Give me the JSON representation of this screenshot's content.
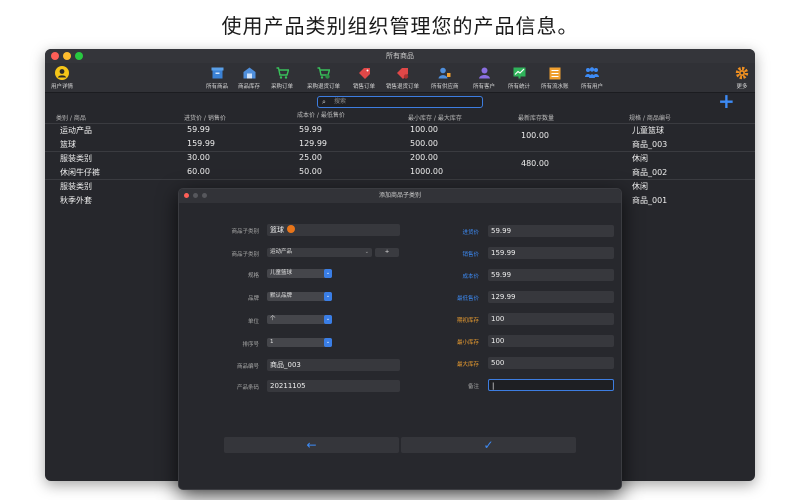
{
  "headline": "使用产品类别组织管理您的产品信息。",
  "window": {
    "title": "所有商品",
    "user_label": "用户详情",
    "more_label": "更多",
    "toolbar": [
      {
        "label": "所有商品",
        "icon": "box-icon"
      },
      {
        "label": "商品库存",
        "icon": "warehouse-icon"
      },
      {
        "label": "采购订单",
        "icon": "cart-icon"
      },
      {
        "label": "采购退货订单",
        "icon": "cart-return-icon"
      },
      {
        "label": "销售订单",
        "icon": "tag-icon"
      },
      {
        "label": "销售退货订单",
        "icon": "tag-return-icon"
      },
      {
        "label": "所有供应商",
        "icon": "supplier-icon"
      },
      {
        "label": "所有客户",
        "icon": "customers-icon"
      },
      {
        "label": "所有统计",
        "icon": "chart-icon"
      },
      {
        "label": "所有流水账",
        "icon": "ledger-icon"
      },
      {
        "label": "所有用户",
        "icon": "users-icon"
      }
    ],
    "search_placeholder": "搜索"
  },
  "table": {
    "headers": [
      "类别 / 商品",
      "进货价 / 销售价",
      "成本价 / 最低售价",
      "最小库存 / 最大库存",
      "最新库存数量",
      "规格 / 商品编号"
    ],
    "rows": [
      {
        "category": "运动产品",
        "product": "篮球",
        "purchase": "59.99",
        "sale": "159.99",
        "cost": "59.99",
        "min_price": "129.99",
        "min_stock": "100.00",
        "max_stock": "500.00",
        "stock": "100.00",
        "spec": "儿童篮球",
        "code": "商品_003"
      },
      {
        "category": "服装类别",
        "product": "休闲牛仔裤",
        "purchase": "30.00",
        "sale": "60.00",
        "cost": "25.00",
        "min_price": "50.00",
        "min_stock": "200.00",
        "max_stock": "1000.00",
        "stock": "480.00",
        "spec": "休闲",
        "code": "商品_002"
      },
      {
        "category": "服装类别",
        "product": "秋季外套",
        "spec": "休闲",
        "code": "商品_001"
      }
    ]
  },
  "dialog": {
    "title": "添加商品子类别",
    "left": {
      "subcategory_label": "商品子类别",
      "subcategory_value": "篮球",
      "category_label": "商品子类别",
      "category_value": "运动产品",
      "spec_label": "规格",
      "spec_value": "儿童篮球",
      "brand_label": "品牌",
      "brand_value": "默认品牌",
      "unit_label": "单位",
      "unit_value": "个",
      "sort_label": "排序号",
      "sort_value": "1",
      "code_label": "商品编号",
      "code_value": "商品_003",
      "barcode_label": "产品条码",
      "barcode_value": "20211105"
    },
    "right": {
      "purchase_label": "进货价",
      "purchase_value": "59.99",
      "sale_label": "销售价",
      "sale_value": "159.99",
      "cost_label": "成本价",
      "cost_value": "59.99",
      "min_price_label": "最低售价",
      "min_price_value": "129.99",
      "init_stock_label": "期初库存",
      "init_stock_value": "100",
      "min_stock_label": "最小库存",
      "min_stock_value": "100",
      "max_stock_label": "最大库存",
      "max_stock_value": "500",
      "note_label": "备注",
      "note_value": ""
    },
    "back_symbol": "←",
    "confirm_symbol": "✓"
  },
  "colors": {
    "accent": "#3d8bf5",
    "orange": "#f0a030"
  }
}
